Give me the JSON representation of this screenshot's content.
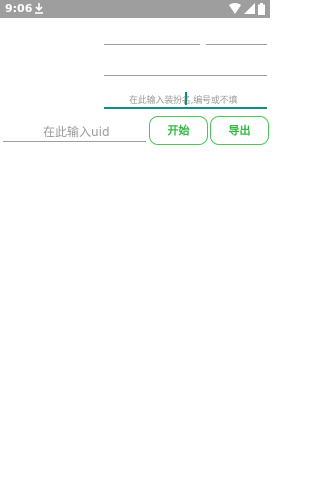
{
  "status_bar": {
    "time": "9:06",
    "icons": [
      "download-icon",
      "wifi-icon",
      "signal-icon",
      "battery-icon"
    ]
  },
  "form": {
    "equip_input": {
      "placeholder": "在此输入装扮名,编号或不填",
      "value": ""
    },
    "uid_input": {
      "placeholder": "在此输入uid",
      "value": ""
    },
    "start_label": "开始",
    "export_label": "导出"
  },
  "colors": {
    "status_bar_bg": "#9e9e9e",
    "accent_teal": "#0f8f83",
    "button_green": "#33b843",
    "hint_gray": "#9a9a9a"
  }
}
